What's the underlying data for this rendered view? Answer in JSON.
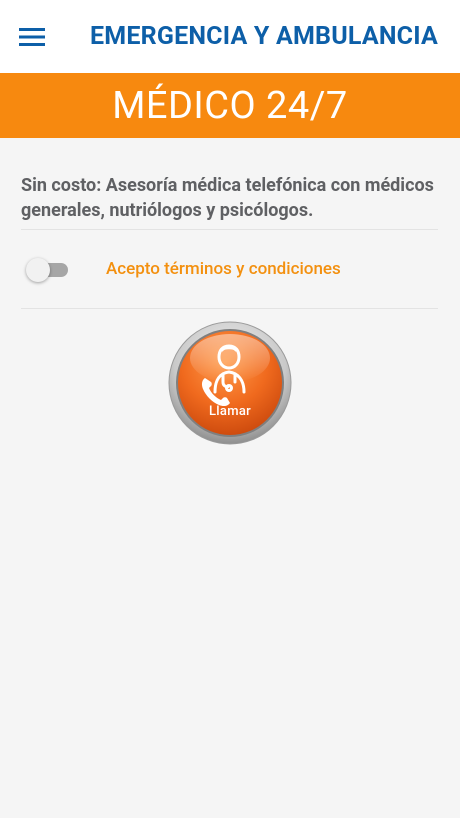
{
  "header": {
    "title": "EMERGENCIA Y AMBULANCIA",
    "menu_icon": "hamburger-menu-icon",
    "title_color": "#0d5fa8"
  },
  "banner": {
    "text": "MÉDICO 24/7",
    "color": "#f7890f"
  },
  "content": {
    "description": "Sin costo: Asesoría médica telefónica con médicos generales, nutriólogos y psicólogos.",
    "terms": {
      "label": "Acepto términos y condiciones",
      "checked": false
    },
    "call_button": {
      "label": "Llamar",
      "icon": "doctor-phone-icon",
      "color": "#f06a1e"
    }
  }
}
